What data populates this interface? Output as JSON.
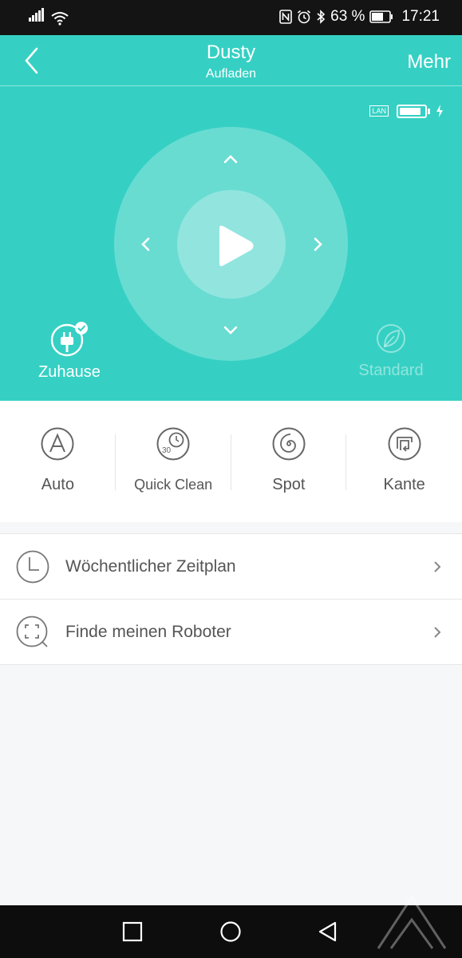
{
  "status_bar": {
    "battery_percent": "63 %",
    "time": "17:21"
  },
  "header": {
    "title": "Dusty",
    "subtitle": "Aufladen",
    "more_label": "Mehr",
    "lan_badge": "LAN"
  },
  "robot": {
    "battery_level": 0.85,
    "charging": true,
    "home_label": "Zuhause",
    "power_mode_label": "Standard"
  },
  "clean_modes": [
    {
      "label": "Auto",
      "icon": "auto-mode-icon"
    },
    {
      "label": "Quick Clean",
      "icon": "quick-clean-icon",
      "badge": "30"
    },
    {
      "label": "Spot",
      "icon": "spot-icon"
    },
    {
      "label": "Kante",
      "icon": "edge-icon"
    }
  ],
  "menu": [
    {
      "label": "Wöchentlicher Zeitplan",
      "icon": "clock-icon"
    },
    {
      "label": "Finde meinen Roboter",
      "icon": "find-robot-icon"
    }
  ],
  "colors": {
    "accent": "#35d0c3",
    "background": "#f6f7f9"
  }
}
